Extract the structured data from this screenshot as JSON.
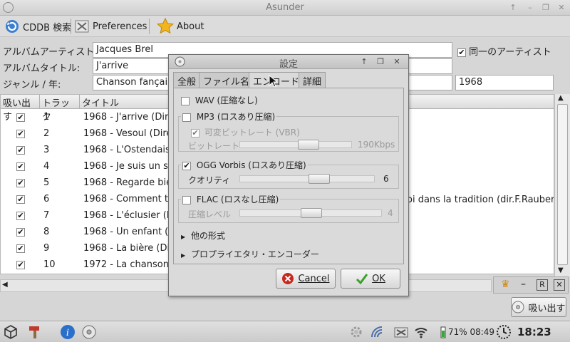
{
  "window": {
    "title": "Asunder"
  },
  "toolbar": {
    "cddb_label": "CDDB 検索",
    "prefs_label": "Preferences",
    "about_label": "About"
  },
  "form": {
    "artist_label": "アルバムアーティスト:",
    "artist_value": "Jacques Brel",
    "title_label": "アルバムタイトル:",
    "title_value": "J'arrive",
    "genre_label": "ジャンル / 年:",
    "genre_value": "Chanson fançaise",
    "year_value": "1968",
    "same_artist_label": "同一のアーティスト",
    "same_artist_checked": true
  },
  "table": {
    "headers": [
      "吸い出す",
      "トラック",
      "タイトル"
    ],
    "rows": [
      {
        "track": "1",
        "title": "1968 - J'arrive  (Dire"
      },
      {
        "track": "2",
        "title": "1968 - Vesoul  (Dire"
      },
      {
        "track": "3",
        "title": "1968 - L'Ostendaise"
      },
      {
        "track": "4",
        "title": "1968 - Je suis un so"
      },
      {
        "track": "5",
        "title": "1968 - Regarde bie"
      },
      {
        "track": "6",
        "title": "1968 - Comment tu"
      },
      {
        "track": "7",
        "title": "1968 - L'éclusier  (D"
      },
      {
        "track": "8",
        "title": "1968 - Un enfant  ("
      },
      {
        "track": "9",
        "title": "1968 - La bière  (Dir"
      },
      {
        "track": "10",
        "title": "1972 - La chanson d"
      }
    ],
    "row6_tail": "oi dans la tradition (dir.F.Rauber)",
    "check_mark": "✔"
  },
  "rip_button": {
    "label": "吸い出す"
  },
  "dialog": {
    "title": "設定",
    "tabs": [
      "全般",
      "ファイル名",
      "エンコード",
      "詳細"
    ],
    "active_tab": "エンコード",
    "wav": {
      "label": "WAV (圧縮なし)",
      "checked": false
    },
    "mp3": {
      "label": "MP3 (ロスあり圧縮)",
      "checked": false,
      "vbr_label": "可変ビットレート (VBR)",
      "vbr_checked": true,
      "bitrate_label": "ビットレート",
      "bitrate_value": "190Kbps",
      "bitrate_level": 0.63
    },
    "ogg": {
      "label": "OGG Vorbis (ロスあり圧縮)",
      "checked": true,
      "quality_label": "クオリティ",
      "quality_value": "6",
      "quality_level": 0.6
    },
    "flac": {
      "label": "FLAC (ロスなし圧縮)",
      "checked": false,
      "compression_label": "圧縮レベル",
      "compression_value": "4",
      "compression_level": 0.5
    },
    "other_formats": "他の形式",
    "proprietary": "プロプライエタリ・エンコーダー",
    "cancel_label": "Cancel",
    "ok_label": "OK"
  },
  "taskbar": {
    "battery": "71% 08:49",
    "clock": "18:23"
  },
  "colors": {
    "cancel_icon": "#c8281e",
    "ok_icon": "#3aa12a",
    "about_star": "#f2b51d",
    "info_icon": "#2a6fc9"
  }
}
